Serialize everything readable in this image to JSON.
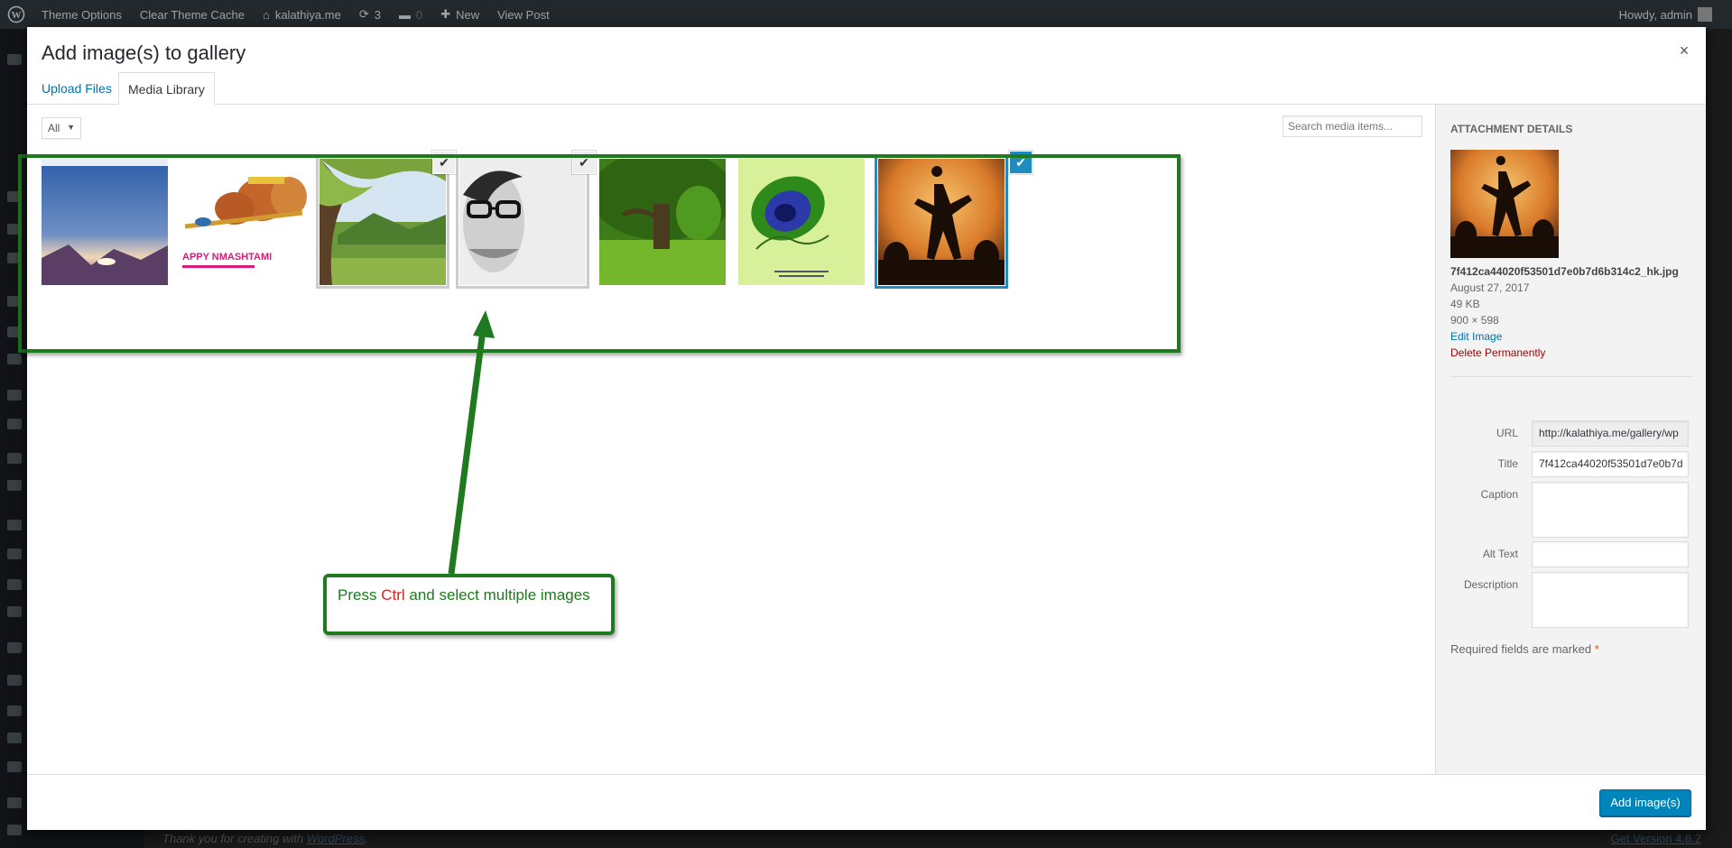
{
  "adminbar": {
    "items": [
      "Theme Options",
      "Clear Theme Cache",
      "kalathiya.me",
      "3",
      "0",
      "New",
      "View Post"
    ],
    "greeting": "Howdy, admin"
  },
  "background_footer": {
    "thanks_prefix": "Thank you for creating with ",
    "thanks_link": "WordPress",
    "thanks_suffix": ".",
    "version_link": "Get Version 4.8.2"
  },
  "modal": {
    "title": "Add image(s) to gallery",
    "close_icon": "×",
    "tabs": [
      {
        "label": "Upload Files",
        "active": false
      },
      {
        "label": "Media Library",
        "active": true
      }
    ],
    "filter": {
      "selected": "All"
    },
    "search": {
      "placeholder": "Search media items..."
    },
    "attachments": [
      {
        "name": "mountain-sunset",
        "state": "none"
      },
      {
        "name": "janmashtami-pots",
        "state": "none",
        "caption": "APPY NMASHTAMI"
      },
      {
        "name": "tree-meadow",
        "state": "selected"
      },
      {
        "name": "man-glasses",
        "state": "selected"
      },
      {
        "name": "green-park",
        "state": "none"
      },
      {
        "name": "peacock-feather",
        "state": "none"
      },
      {
        "name": "dancer-silhouette",
        "state": "details"
      }
    ],
    "check_icon": "✔",
    "annotation": {
      "text_before": "Press ",
      "key": "Ctrl",
      "text_after": " and select multiple images",
      "color": "#1f7a1f",
      "key_color": "#d9231b"
    },
    "sidebar": {
      "heading": "Attachment Details",
      "filename": "7f412ca44020f53501d7e0b7d6b314c2_hk.jpg",
      "date": "August 27, 2017",
      "filesize": "49 KB",
      "dimensions": "900 × 598",
      "edit_link": "Edit Image",
      "delete_link": "Delete Permanently",
      "fields": {
        "url_label": "URL",
        "url_value": "http://kalathiya.me/gallery/wp",
        "title_label": "Title",
        "title_value": "7f412ca44020f53501d7e0b7d",
        "caption_label": "Caption",
        "alt_label": "Alt Text",
        "description_label": "Description"
      },
      "required_note": "Required fields are marked",
      "required_star": "*"
    },
    "toolbar": {
      "add_button": "Add image(s)"
    },
    "colors": {
      "accent": "#0085ba",
      "link": "#0073aa",
      "selected_border": "#1e8cbe",
      "annotation_green": "#1f7a1f"
    }
  }
}
